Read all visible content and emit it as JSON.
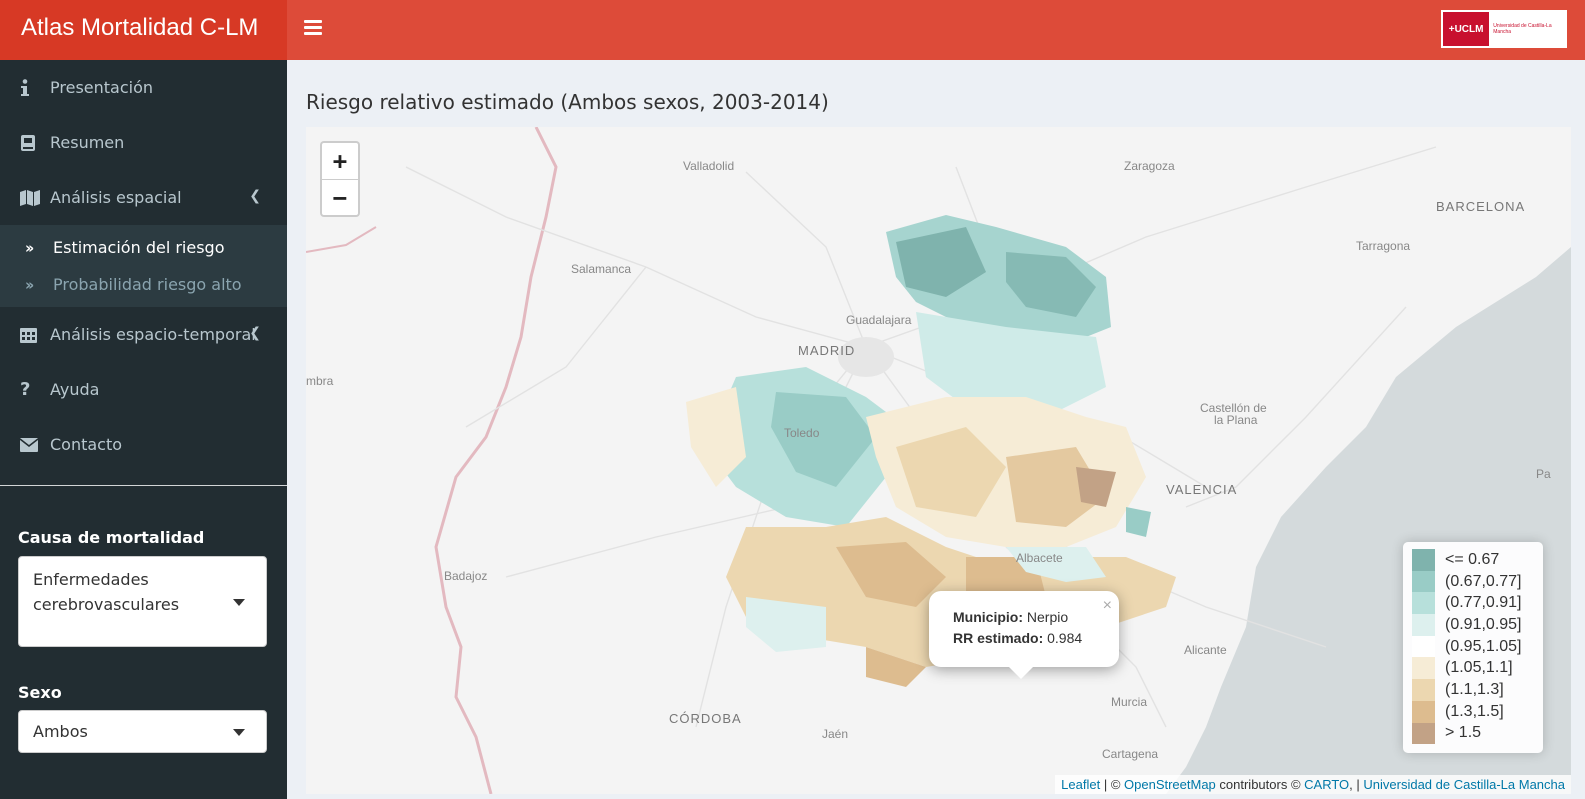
{
  "app": {
    "title": "Atlas Mortalidad C-LM",
    "logo_text": "+UCLM",
    "logo_subtitle": "Universidad de Castilla-La Mancha"
  },
  "sidebar": {
    "items": [
      {
        "label": "Presentación",
        "icon": "info-icon"
      },
      {
        "label": "Resumen",
        "icon": "book-icon"
      },
      {
        "label": "Análisis espacial",
        "icon": "map-icon"
      },
      {
        "label": "Análisis espacio-temporal",
        "icon": "calendar-icon"
      },
      {
        "label": "Ayuda",
        "icon": "question-icon"
      },
      {
        "label": "Contacto",
        "icon": "envelope-icon"
      }
    ],
    "submenu": [
      {
        "label": "Estimación del riesgo",
        "active": true
      },
      {
        "label": "Probabilidad riesgo alto",
        "active": false
      }
    ],
    "cause_label": "Causa de mortalidad",
    "cause_value": "Enfermedades cerebrovasculares",
    "sex_label": "Sexo",
    "sex_value": "Ambos"
  },
  "main": {
    "title": "Riesgo relativo estimado (Ambos sexos, 2003-2014)"
  },
  "map": {
    "cities": {
      "valladolid": "Valladolid",
      "zaragoza": "Zaragoza",
      "barcelona": "BARCELONA",
      "tarragona": "Tarragona",
      "salamanca": "Salamanca",
      "guadalajara": "Guadalajara",
      "madrid": "MADRID",
      "coimbra": "mbra",
      "castellon1": "Castellón de",
      "castellon2": "la Plana",
      "toledo": "Toledo",
      "valencia": "VALENCIA",
      "badajoz": "Badajoz",
      "albacete": "Albacete",
      "alicante": "Alicante",
      "murcia": "Murcia",
      "cordoba": "CÓRDOBA",
      "jaen": "Jaén",
      "cartagena": "Cartagena",
      "pa": "Pa"
    },
    "zoom_in": "+",
    "zoom_out": "−",
    "popup": {
      "municipio_label": "Municipio:",
      "municipio": "Nerpio",
      "rr_label": "RR estimado:",
      "rr": "0.984",
      "close": "×"
    },
    "legend": [
      {
        "label": "<= 0.67",
        "color": "#7fb3ad"
      },
      {
        "label": "(0.67,0.77]",
        "color": "#99ccc6"
      },
      {
        "label": "(0.77,0.91]",
        "color": "#b7e0db"
      },
      {
        "label": "(0.91,0.95]",
        "color": "#ddf0ee"
      },
      {
        "label": "(0.95,1.05]",
        "color": "#ffffff"
      },
      {
        "label": "(1.05,1.1]",
        "color": "#f6ecd6"
      },
      {
        "label": "(1.1,1.3]",
        "color": "#ecd7b0"
      },
      {
        "label": "(1.3,1.5]",
        "color": "#ddbc8f"
      },
      {
        "label": "> 1.5",
        "color": "#c2a286"
      }
    ],
    "attribution": {
      "leaflet": "Leaflet",
      "sep1": " | © ",
      "osm": "OpenStreetMap",
      "mid": " contributors © ",
      "carto": "CARTO",
      "sep2": ", | ",
      "uclm": "Universidad de Castilla-La Mancha"
    }
  }
}
